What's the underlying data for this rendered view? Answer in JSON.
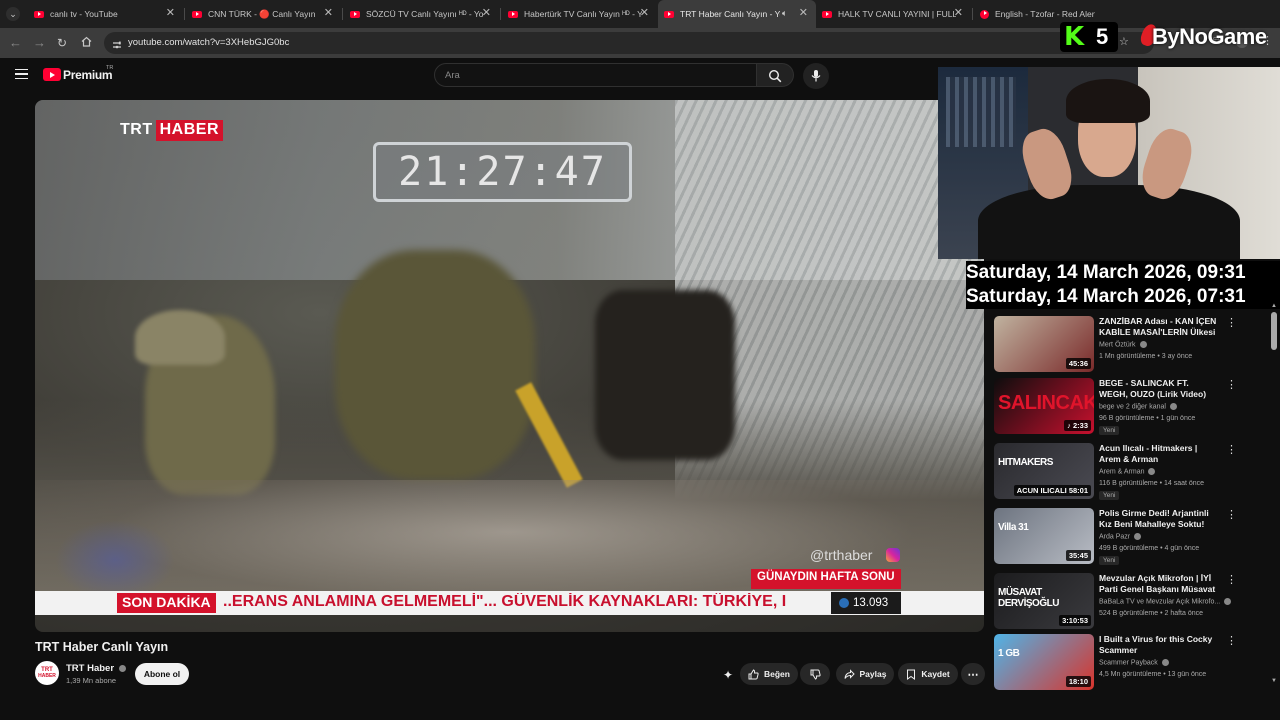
{
  "browser": {
    "tabs": [
      {
        "title": "canlı tv - YouTube"
      },
      {
        "title": "CNN TÜRK - 🔴 Canlı Yayın"
      },
      {
        "title": "SÖZCÜ TV Canlı Yayını ᴴᴰ - You"
      },
      {
        "title": "Habertürk TV Canlı Yayın ᴴᴰ - Yo"
      },
      {
        "title": "TRT Haber Canlı Yayın - You"
      },
      {
        "title": "HALK TV CANLI YAYINI | FULL"
      },
      {
        "title": "English - Tzofar - Red Alert"
      }
    ],
    "url": "youtube.com/watch?v=3XHebGJG0bc"
  },
  "overlay": {
    "k_badge": "K",
    "k_count": "5",
    "brand": "ByNoGame",
    "clock_line_1": "Saturday, 14 March 2026, 09:31",
    "clock_line_2": "Saturday, 14 March 2026, 07:31"
  },
  "header": {
    "logo_text": "Premium",
    "logo_region": "TR",
    "search_placeholder": "Ara"
  },
  "video": {
    "channel_logo_a": "TRT",
    "channel_logo_b": "HABER",
    "clock": "21:27:47",
    "instagram": "@trthaber",
    "show_name": "GÜNAYDIN HAFTA SONU",
    "breaking_label": "SON DAKİKA",
    "ticker": "..ERANS ANLAMINA GELMEMELİ\"... GÜVENLİK KAYNAKLARI: TÜRKİYE, I",
    "viewers": "13.093"
  },
  "meta": {
    "title": "TRT Haber Canlı Yayın",
    "channel": "TRT Haber",
    "subscribers": "1,39 Mn abone",
    "subscribe_label": "Abone ol",
    "like_label": "Beğen",
    "share_label": "Paylaş",
    "save_label": "Kaydet"
  },
  "recommendations": [
    {
      "title": "ZANZİBAR Adası - KAN İÇEN KABİLE MASAİ'LERİN Ülkesi 🇹🇿",
      "channel": "Mert Öztürk",
      "meta": "1 Mn görüntüleme • 3 ay önce",
      "duration": "45:36",
      "badge": "",
      "thumb": "#c0b3a0",
      "thumb2": "#7a2a2a"
    },
    {
      "title": "BEGE - SALINCAK FT. WEGH, OUZO (Lirik Video)",
      "channel": "bege ve 2 diğer kanal",
      "meta": "96 B görüntüleme • 1 gün önce",
      "duration": "♪ 2:33",
      "badge": "Yeni",
      "thumb": "#0d0d0d",
      "thumb2": "#c8102e",
      "thumb_text": "SALINCAK"
    },
    {
      "title": "Acun Ilıcalı - Hitmakers | Arem & Arman",
      "channel": "Arem & Arman",
      "meta": "116 B görüntüleme • 14 saat önce",
      "duration": "ACUN ILICALI 58:01",
      "badge": "Yeni",
      "thumb": "#2a2a2e",
      "thumb2": "#4a4a52",
      "thumb_text": "HITMAKERS"
    },
    {
      "title": "Polis Girme Dedi! Arjantinli Kız Beni Mahalleye Soktu! Villa 31",
      "channel": "Arda Pazr",
      "meta": "499 B görüntüleme • 4 gün önce",
      "duration": "35:45",
      "badge": "Yeni",
      "thumb": "#6d7480",
      "thumb2": "#b8bcc4",
      "thumb_text": "Villa 31"
    },
    {
      "title": "Mevzular Açık Mikrofon | İYİ Parti Genel Başkanı Müsavat ...",
      "channel": "BaBaLa TV ve Mevzular Açık Mikrofo...",
      "meta": "524 B görüntüleme • 2 hafta önce",
      "duration": "3:10:53",
      "badge": "",
      "thumb": "#1c1c1e",
      "thumb2": "#3a3a3e",
      "thumb_text": "MÜSAVAT DERVİŞOĞLU"
    },
    {
      "title": "I Built a Virus for this Cocky Scammer",
      "channel": "Scammer Payback",
      "meta": "4,5 Mn görüntüleme • 13 gün önce",
      "duration": "18:10",
      "badge": "",
      "thumb": "#4fb4e8",
      "thumb2": "#d8342c",
      "thumb_text": "1 GB"
    }
  ]
}
